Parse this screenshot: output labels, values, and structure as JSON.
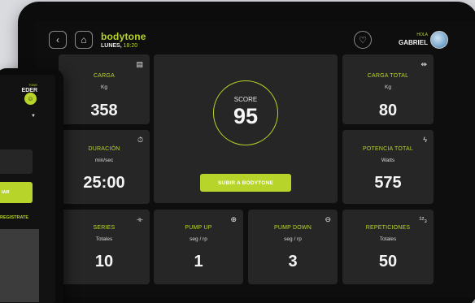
{
  "header": {
    "brand": "bodytone",
    "day": "LUNES,",
    "time": "18:20",
    "greeting": "HOLA",
    "user_name": "GABRIEL"
  },
  "cards": {
    "carga": {
      "title": "CARGA",
      "unit": "Kg",
      "value": "358",
      "icon": "weight-plate-icon"
    },
    "carga_total": {
      "title": "CARGA TOTAL",
      "unit": "Kg",
      "value": "80",
      "icon": "total-load-icon"
    },
    "duracion": {
      "title": "DURACIÓN",
      "unit": "min/sec",
      "value": "25:00",
      "icon": "stopwatch-icon"
    },
    "potencia_total": {
      "title": "POTENCIA TOTAL",
      "unit": "Watts",
      "value": "575",
      "icon": "lightning-icon"
    },
    "series": {
      "title": "SERIES",
      "unit": "Totales",
      "value": "10",
      "icon": "dumbbell-icon"
    },
    "pump_up": {
      "title": "PUMP UP",
      "unit": "seg / rp",
      "value": "1",
      "icon": "arrow-up-circle-icon"
    },
    "pump_down": {
      "title": "PUMP DOWN",
      "unit": "seg / rp",
      "value": "3",
      "icon": "arrow-down-circle-icon"
    },
    "repeticiones": {
      "title": "REPETICIONES",
      "unit": "Totales",
      "value": "50",
      "icon": "counter-icon"
    }
  },
  "score": {
    "label": "SCORE",
    "value": "95",
    "button": "SUBIR A BODYTONE"
  },
  "phone": {
    "small_label": "TONE",
    "acceder": "EDER",
    "button": "IAR",
    "register": "REGISTRATE"
  },
  "colors": {
    "accent": "#b6d42a",
    "card": "#262626",
    "background": "#0e0e0e"
  }
}
